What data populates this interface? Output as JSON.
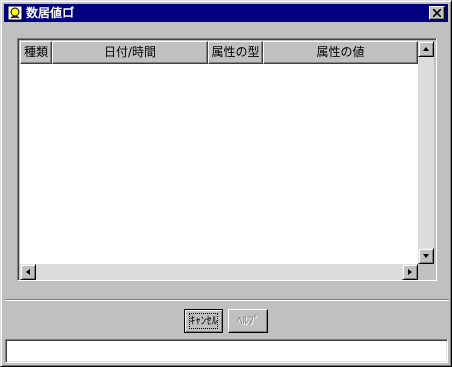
{
  "window": {
    "title": "数居値ロ゙"
  },
  "table": {
    "columns": [
      "種類",
      "日付/時間",
      "属性の型",
      "属性の値"
    ],
    "rows": []
  },
  "buttons": {
    "cancel_label": "ｷｬﾝｾﾙ",
    "help_label": "ﾍﾙﾌﾟ"
  },
  "status": {
    "text": ""
  },
  "icons": {
    "title": "app-icon",
    "close": "close-icon",
    "scroll_up": "arrow-up-icon",
    "scroll_down": "arrow-down-icon",
    "scroll_left": "arrow-left-icon",
    "scroll_right": "arrow-right-icon"
  },
  "colors": {
    "titlebar": "#000080",
    "face": "#c0c0c0",
    "table_background": "#ffffff",
    "disabled_text": "#808080"
  }
}
